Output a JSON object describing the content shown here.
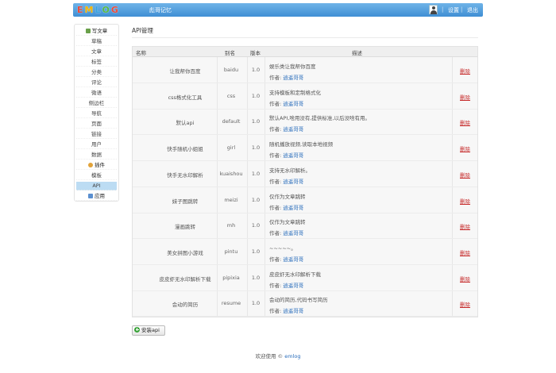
{
  "header": {
    "logo_letters": [
      "E",
      "M",
      "L",
      "O",
      "G"
    ],
    "logo_colors": [
      "#e94b3c",
      "#f4b400",
      "#37a3e0",
      "#57b847",
      "#e94b3c"
    ],
    "site_title": "彪哥记忆",
    "settings_label": "设置",
    "logout_label": "退出",
    "separator": "|"
  },
  "sidebar": {
    "items": [
      {
        "label": "写文章",
        "icon": "write-icon"
      },
      {
        "label": "草稿"
      },
      {
        "label": "文章"
      },
      {
        "label": "标签"
      },
      {
        "label": "分类"
      },
      {
        "label": "评论"
      },
      {
        "label": "微语"
      },
      {
        "label": "侧边栏"
      },
      {
        "label": "导航"
      },
      {
        "label": "页面"
      },
      {
        "label": "链接"
      },
      {
        "label": "用户"
      },
      {
        "label": "数据"
      },
      {
        "label": "插件",
        "icon": "plugin-icon"
      },
      {
        "label": "模板"
      },
      {
        "label": "API",
        "active": true
      },
      {
        "label": "应用",
        "icon": "app-icon"
      }
    ]
  },
  "main": {
    "page_title": "API管理",
    "columns": [
      "名称",
      "别名",
      "版本",
      "描述"
    ],
    "author_prefix": "作者:",
    "delete_label": "删除",
    "rows": [
      {
        "name": "让我帮你百度",
        "alias": "baidu",
        "version": "1.0",
        "desc": "娱乐类让我帮你百度",
        "author": "逍遥哥哥"
      },
      {
        "name": "css格式化工具",
        "alias": "css",
        "version": "1.0",
        "desc": "支持模板和定制格式化",
        "author": "逍遥哥哥"
      },
      {
        "name": "默认api",
        "alias": "default",
        "version": "1.0",
        "desc": "默认API,啥用没有,提供标准,以后没啥有用。",
        "author": "逍遥哥哥"
      },
      {
        "name": "快手随机小姐姐",
        "alias": "girl",
        "version": "1.0",
        "desc": "随机播放视频,读取本地视频",
        "author": "逍遥哥哥"
      },
      {
        "name": "快手无水印解析",
        "alias": "kuaishou",
        "version": "1.0",
        "desc": "支持无水印解析。",
        "author": "逍遥哥哥"
      },
      {
        "name": "妹子图跳转",
        "alias": "meizi",
        "version": "1.0",
        "desc": "仅作为文章跳转",
        "author": "逍遥哥哥"
      },
      {
        "name": "漫画跳转",
        "alias": "mh",
        "version": "1.0",
        "desc": "仅作为文章跳转",
        "author": "逍遥哥哥"
      },
      {
        "name": "美女拼图小游戏",
        "alias": "pintu",
        "version": "1.0",
        "desc": "~~~~~。",
        "author": "逍遥哥哥"
      },
      {
        "name": "皮皮虾无水印解析下载",
        "alias": "pipixia",
        "version": "1.0",
        "desc": "皮皮虾无水印解析下载",
        "author": "逍遥哥哥"
      },
      {
        "name": "会动的简历",
        "alias": "resume",
        "version": "1.0",
        "desc": "会动的简历,代码书写简历",
        "author": "逍遥哥哥"
      }
    ],
    "install_label": "安装api"
  },
  "footer": {
    "text": "欢迎使用 ©",
    "link": "emlog"
  }
}
